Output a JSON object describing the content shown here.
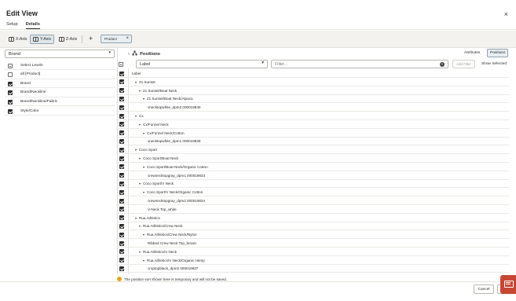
{
  "dialog": {
    "title": "Edit View",
    "close_glyph": "×"
  },
  "tabs": [
    {
      "label": "Setup",
      "active": false
    },
    {
      "label": "Details",
      "active": true
    }
  ],
  "toolbar": {
    "axes": [
      {
        "label": "X-Axis",
        "selected": false
      },
      {
        "label": "Y-Axis",
        "selected": true
      },
      {
        "label": "Z-Axis",
        "selected": false
      }
    ],
    "add_glyph": "+",
    "chip": {
      "label": "Product",
      "remove_glyph": "×"
    }
  },
  "left": {
    "hierarchy_select": "Brand",
    "levels": [
      {
        "label": "Select Levels",
        "state": "indeterminate"
      },
      {
        "label": "all [Product]",
        "state": "off"
      },
      {
        "label": "Brand",
        "state": "on"
      },
      {
        "label": "Brand/Neckline",
        "state": "on"
      },
      {
        "label": "Brand/Neckline/Fabric",
        "state": "on"
      },
      {
        "label": "Style/Color",
        "state": "on"
      }
    ]
  },
  "right": {
    "nav_glyph": "‹",
    "title": "Positions",
    "buttons": {
      "attributes": "Attributes",
      "positions": "Positions",
      "show_selected": "Show Selected"
    },
    "attribute_select": "Label",
    "filter_placeholder": "Filter...",
    "clear_glyph": "×",
    "add_filter": "Add Filter",
    "rows": [
      {
        "text": "Label",
        "level": 0,
        "toggle": ""
      },
      {
        "text": "21 Sunset",
        "level": 1,
        "toggle": "▾"
      },
      {
        "text": "21 Sunset/Boat Neck",
        "level": 2,
        "toggle": "▾"
      },
      {
        "text": "21 Sunset/Boat Neck/Alpaca",
        "level": 3,
        "toggle": "▾"
      },
      {
        "text": "vnecktopwhite_dpm2 000019840",
        "level": 4,
        "toggle": ""
      },
      {
        "text": "Cx",
        "level": 1,
        "toggle": "▾"
      },
      {
        "text": "Cx/Funnel Neck",
        "level": 2,
        "toggle": "▾"
      },
      {
        "text": "Cx/Funnel Neck/Cotton",
        "level": 3,
        "toggle": "▾"
      },
      {
        "text": "vnecktopwhite_dpm1 000019839",
        "level": 4,
        "toggle": ""
      },
      {
        "text": "Coco Sport",
        "level": 1,
        "toggle": "▾"
      },
      {
        "text": "Coco Sport/Boat Neck",
        "level": 2,
        "toggle": "▾"
      },
      {
        "text": "Coco Sport/Boat Neck/Organic Cotton",
        "level": 3,
        "toggle": "▾"
      },
      {
        "text": "crewnecktopgray_dpm1 000019833",
        "level": 4,
        "toggle": ""
      },
      {
        "text": "Coco Sport/V Neck",
        "level": 2,
        "toggle": "▾"
      },
      {
        "text": "Coco Sport/V Neck/Organic Cotton",
        "level": 3,
        "toggle": "▾"
      },
      {
        "text": "crewnecktopgray_dpm2 000019834",
        "level": 4,
        "toggle": ""
      },
      {
        "text": "V-Neck Top_white",
        "level": 4,
        "toggle": ""
      },
      {
        "text": "Rua Athletics",
        "level": 1,
        "toggle": "▾"
      },
      {
        "text": "Rua Athletics/Crew Neck",
        "level": 2,
        "toggle": "▾"
      },
      {
        "text": "Rua Athletics/Crew Neck/Nylon",
        "level": 3,
        "toggle": "▾"
      },
      {
        "text": "Ribbed Crew Neck Top_brown",
        "level": 4,
        "toggle": ""
      },
      {
        "text": "Rua Athletics/V Neck",
        "level": 2,
        "toggle": "▾"
      },
      {
        "text": "Rua Athletics/V Neck/Organic Hemp",
        "level": 3,
        "toggle": "▾"
      },
      {
        "text": "croptopblack_dpm2 000019837",
        "level": 4,
        "toggle": ""
      }
    ]
  },
  "footer": {
    "note": "The position sort shown here is temporary and will not be saved.",
    "cancel": "Cancel"
  },
  "colors": {
    "accent_red": "#c74634",
    "warning": "#e3a520",
    "selected_bg": "#dfe6ea"
  }
}
